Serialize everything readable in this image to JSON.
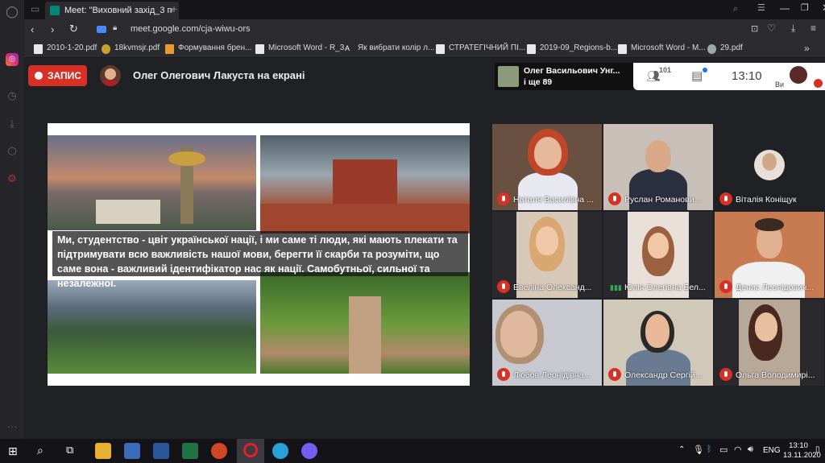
{
  "browser": {
    "tab_title": "Meet: \"Виховний захід_3 п",
    "new_tab": "+",
    "url": "meet.google.com/cja-wiwu-ors",
    "bookmarks": [
      "2010-1-20.pdf",
      "18kvmsjr.pdf",
      "Формування брен...",
      "Microsoft Word - R_3",
      "Як вибрати колір л...",
      "СТРАТЕГІЧНИЙ ПІ...",
      "2019-09_Regions-b...",
      "Microsoft Word - M...",
      "29.pdf"
    ],
    "more_bookmarks": "»"
  },
  "meet": {
    "record_label": "ЗАПИС",
    "presenter_label": "Олег Олегович Лакуста на екрані",
    "pin_name_line1": "Олег Васильович Унг...",
    "pin_name_line2": "і ще 89",
    "people_count": "101",
    "clock": "13:10",
    "self_label": "Ви",
    "slide_text": "Ми, студентство - цвіт української нації, і ми саме ті люди, які мають плекати та підтримувати всю важливість нашої мови, берегти її скарби та розуміти, що саме вона - важливий ідентифікатор нас як нації. Самобутньої, сильної та  незалежної.",
    "participants": [
      "Наталя Василівна ...",
      "Руслан Романови...",
      "Віталія Коніщук",
      "Евеліна Олександ...",
      "Юлія Олегівна Бел...",
      "Денис Леонідович...",
      "Любов Леонідівна...",
      "Олександр Сергій...",
      "Ольга Володимирі..."
    ]
  },
  "taskbar": {
    "time": "13:10",
    "date": "13.11.2020",
    "lang": "ENG"
  },
  "colors": {
    "record_red": "#d93025",
    "meet_bg": "#202124",
    "tile_bg": "#3c4043"
  }
}
